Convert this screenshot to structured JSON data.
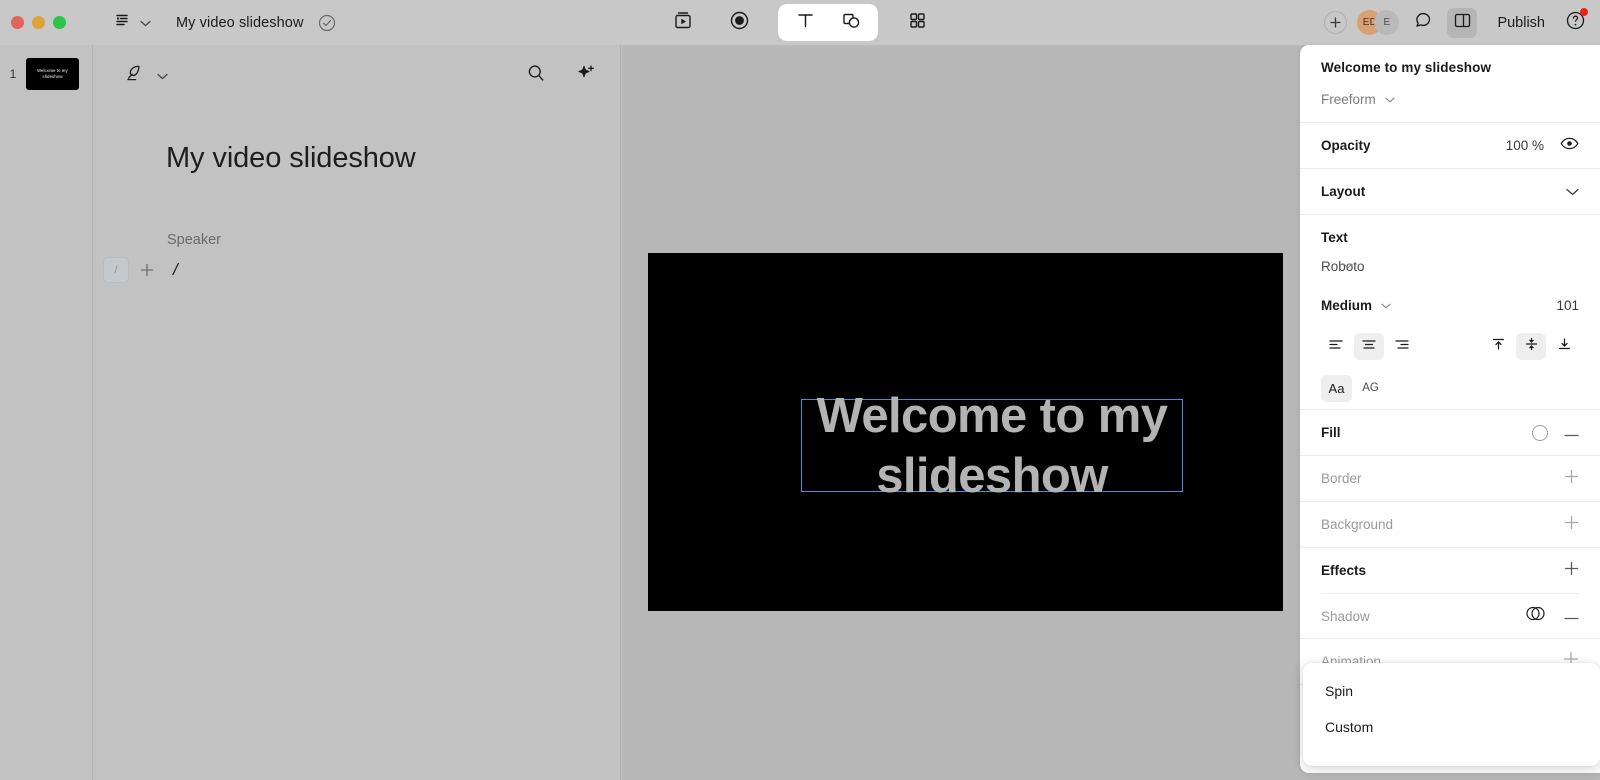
{
  "topbar": {
    "window_controls": [
      "close",
      "minimize",
      "maximize"
    ],
    "doc_menu_icon": "document-outline-icon",
    "doc_title": "My video slideshow",
    "saved_icon": "check-circle-icon",
    "center_tools": [
      {
        "name": "media-icon",
        "label": "Media"
      },
      {
        "name": "record-icon",
        "label": "Record"
      },
      {
        "name": "text-tool-icon",
        "label": "T"
      },
      {
        "name": "shapes-tool-icon",
        "label": "Shapes"
      },
      {
        "name": "grid-icon",
        "label": "Templates"
      }
    ],
    "add_label": "+",
    "avatars": [
      {
        "initials": "ED",
        "color": "#d9a072"
      },
      {
        "initials": "E",
        "color": "#b9b9b9"
      }
    ],
    "comment_icon": "comment-icon",
    "panel_toggle_icon": "right-panel-icon",
    "publish_label": "Publish",
    "help_icon": "question-circle-icon",
    "help_badge_color": "#e3261b"
  },
  "rail": {
    "slides": [
      {
        "number": "1",
        "thumb_text": "Welcome to my slideshow"
      }
    ]
  },
  "script": {
    "quill_icon": "quill-pen-icon",
    "chevron_icon": "chevron-down-icon",
    "search_icon": "search-icon",
    "ai_icon": "sparkle-plus-icon",
    "title": "My video slideshow",
    "speaker_label": "Speaker",
    "slash_chip": "/",
    "add_block": "+",
    "cursor_text": "/"
  },
  "canvas": {
    "slide_background": "#000000",
    "text": "Welcome to my slideshow",
    "text_color": "#b3b3b3",
    "selection_color": "#4a90d9"
  },
  "inspector": {
    "title": "Welcome to my slideshow",
    "type": "Freeform",
    "opacity": {
      "label": "Opacity",
      "value": "100 %",
      "icon": "eye-icon"
    },
    "layout": {
      "label": "Layout",
      "icon": "chevron-down-icon"
    },
    "text": {
      "label": "Text",
      "font": "Roboto",
      "weight": "Medium",
      "size": "101",
      "align_h": [
        "left",
        "center",
        "right"
      ],
      "align_h_active": "center",
      "align_v": [
        "top",
        "middle",
        "bottom"
      ],
      "align_v_active": "middle",
      "case_buttons": [
        "Aa",
        "AG"
      ],
      "case_active": "Aa"
    },
    "fill": {
      "label": "Fill",
      "swatch": "#ffffff",
      "action": "minus"
    },
    "border": {
      "label": "Border",
      "action": "plus"
    },
    "background": {
      "label": "Background",
      "action": "plus"
    },
    "effects": {
      "label": "Effects",
      "action": "plus"
    },
    "shadow": {
      "label": "Shadow",
      "icon": "shadow-swatch-icon",
      "action": "minus"
    },
    "animation": {
      "label": "Animation",
      "action": "plus"
    }
  },
  "menu": {
    "items": [
      {
        "label": "Spin"
      },
      {
        "label": "Custom"
      }
    ]
  }
}
